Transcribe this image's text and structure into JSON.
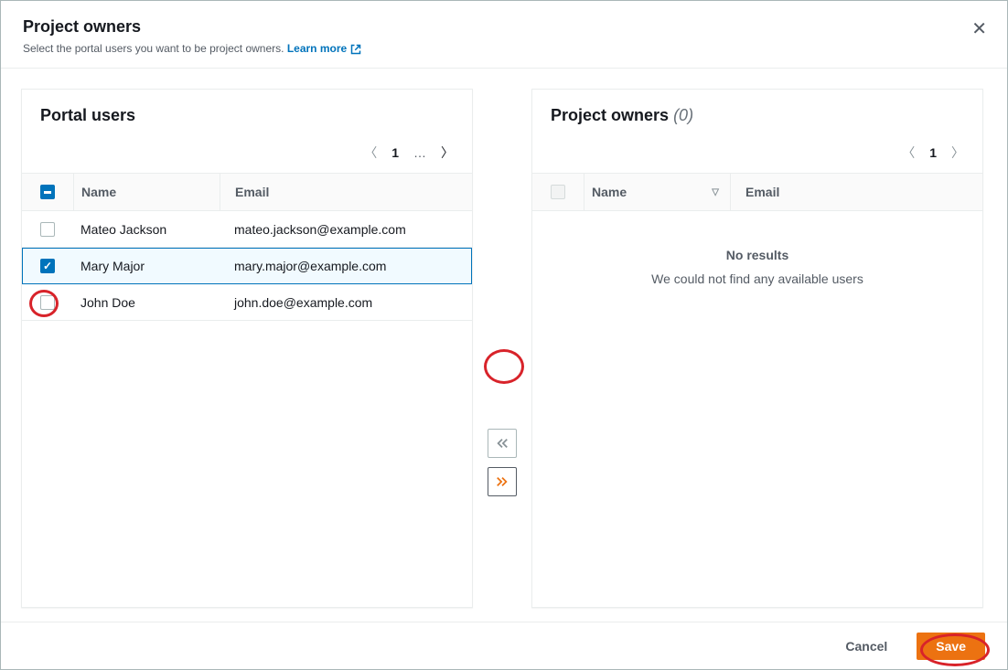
{
  "header": {
    "title": "Project owners",
    "subtitle_prefix": "Select the portal users you want to be project owners. ",
    "learn_more": "Learn more"
  },
  "left_panel": {
    "title": "Portal users",
    "pagination": {
      "page": "1",
      "ellipsis": "…"
    },
    "columns": {
      "name": "Name",
      "email": "Email"
    },
    "rows": [
      {
        "name": "Mateo Jackson",
        "email": "mateo.jackson@example.com",
        "checked": false
      },
      {
        "name": "Mary Major",
        "email": "mary.major@example.com",
        "checked": true
      },
      {
        "name": "John Doe",
        "email": "john.doe@example.com",
        "checked": false
      }
    ]
  },
  "right_panel": {
    "title": "Project owners",
    "count": "(0)",
    "pagination": {
      "page": "1"
    },
    "columns": {
      "name": "Name",
      "email": "Email"
    },
    "empty": {
      "title": "No results",
      "message": "We could not find any available users"
    }
  },
  "footer": {
    "cancel": "Cancel",
    "save": "Save"
  }
}
